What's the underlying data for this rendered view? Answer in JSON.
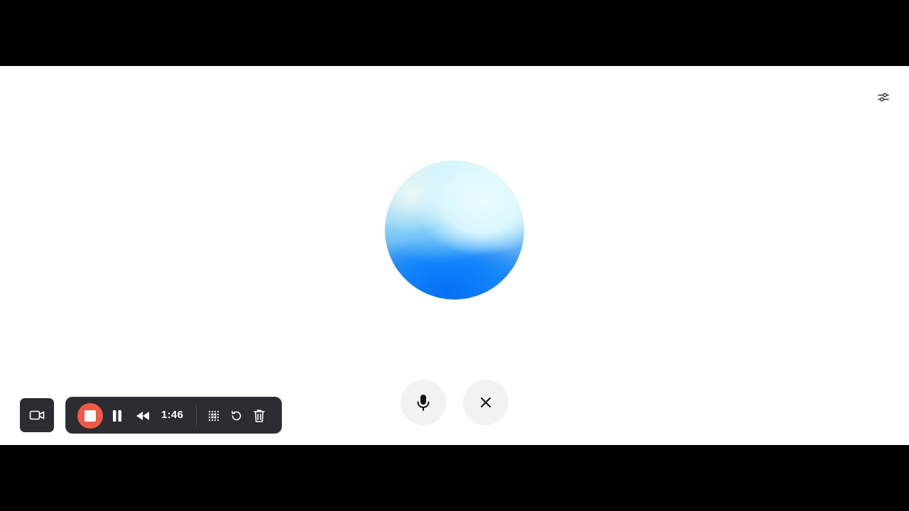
{
  "recorder": {
    "elapsed_time": "1:46",
    "stop_color": "#ef5a45"
  },
  "icons": {
    "settings": "sliders-icon",
    "mic": "microphone-icon",
    "close": "close-icon",
    "camera": "video-camera-icon",
    "pause": "pause-icon",
    "rewind": "rewind-icon",
    "grid": "dot-grid-icon",
    "restart": "restart-icon",
    "trash": "trash-icon"
  },
  "colors": {
    "background": "#ffffff",
    "letterbox": "#000000",
    "toolbar": "#2b2d31",
    "round_button": "#f2f2f2"
  }
}
